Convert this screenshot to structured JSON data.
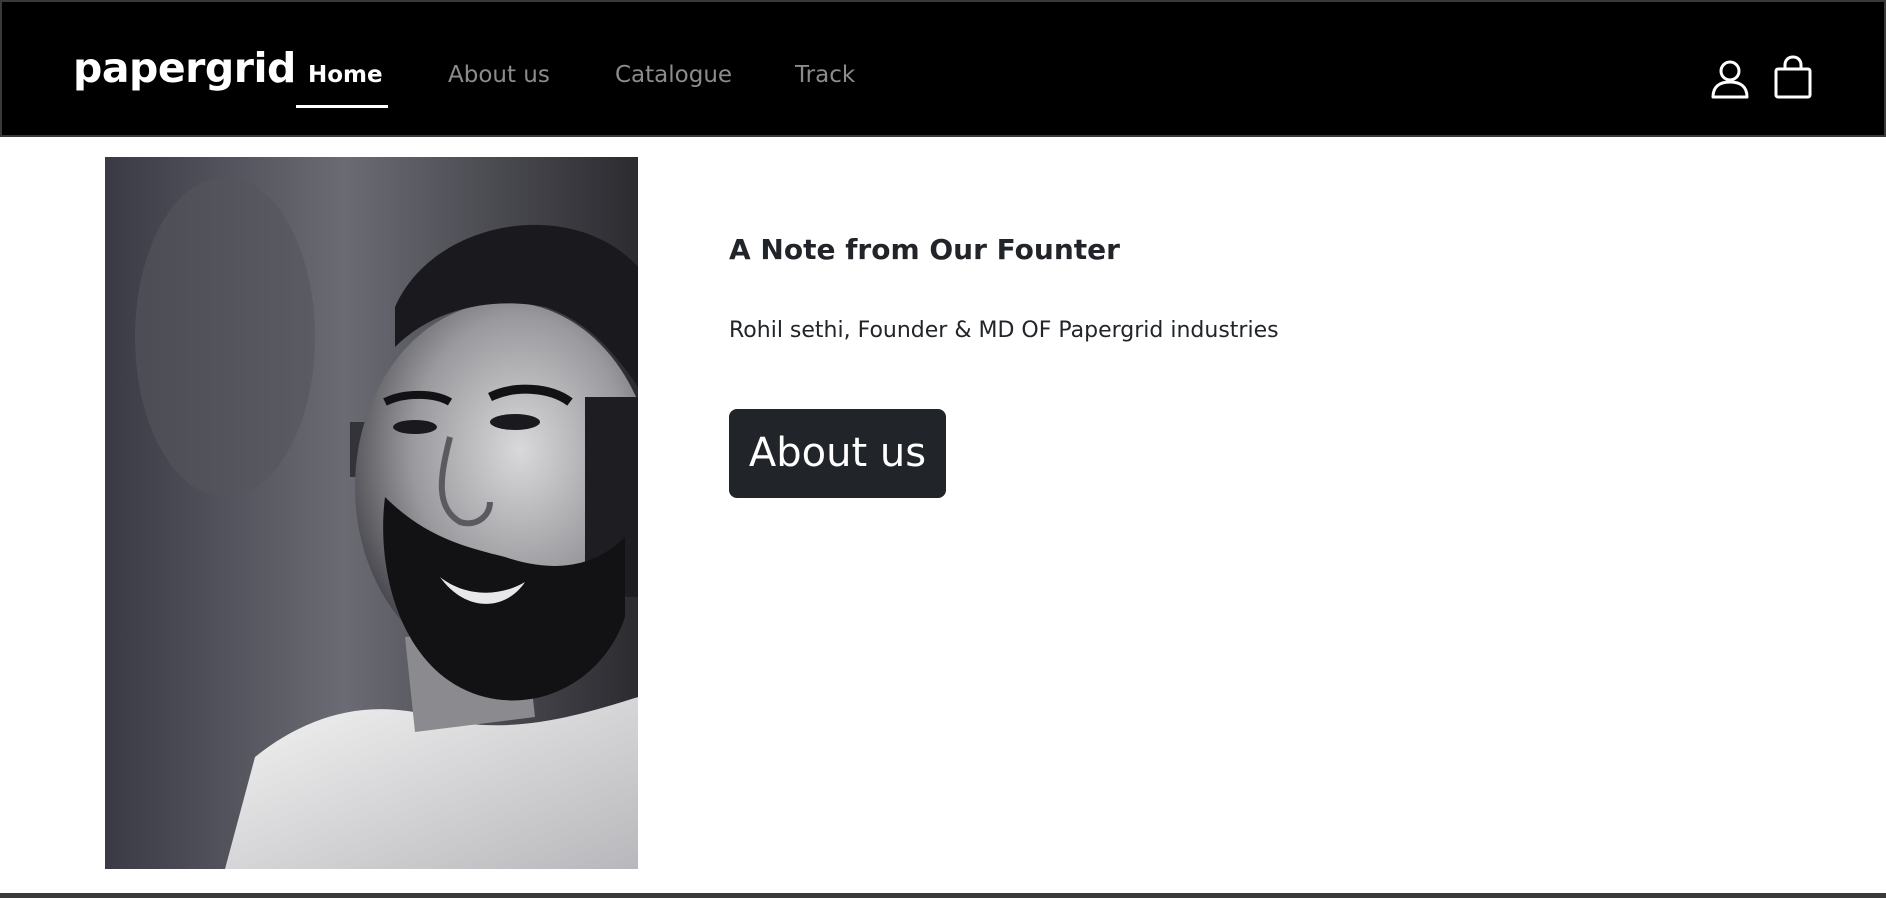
{
  "brand": "papergrid",
  "nav": {
    "items": [
      {
        "label": "Home",
        "active": true
      },
      {
        "label": "About us",
        "active": false
      },
      {
        "label": "Catalogue",
        "active": false
      },
      {
        "label": "Track",
        "active": false
      }
    ],
    "icons": [
      "user-icon",
      "shopping-bag-icon"
    ]
  },
  "founder": {
    "photo_description_icon": "founder-portrait",
    "title": "A Note from Our Founter",
    "subtitle": "Rohil sethi, Founder & MD OF Papergrid industries",
    "button_label": "About us"
  },
  "colors": {
    "navbar_bg": "#000000",
    "nav_active": "#ffffff",
    "nav_inactive": "#8c8c8c",
    "button_bg": "#212529",
    "text": "#212529"
  }
}
